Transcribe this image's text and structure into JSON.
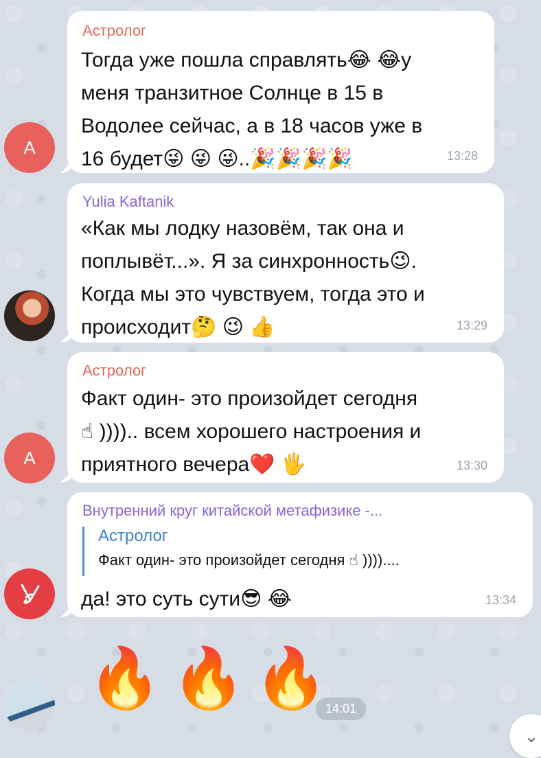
{
  "messages": [
    {
      "sender": "Астролог",
      "avatar_letter": "А",
      "lines": [
        "Тогда уже пошла справлять😂 😂у",
        "меня транзитное Солнце в 15 в",
        "Водолее сейчас, а в 18 часов уже в",
        "16 будет😜 😜 😜..🎉🎉🎉🎉"
      ],
      "time": "13:28"
    },
    {
      "sender": "Yulia Kaftanik",
      "lines": [
        "«Как мы лодку назовём, так она и",
        "поплывёт...». Я за синхронность😉.",
        "Когда мы это чувствуем, тогда это и",
        "происходит🤔 😉 👍"
      ],
      "time": "13:29"
    },
    {
      "sender": "Астролог",
      "avatar_letter": "А",
      "lines": [
        "Факт один- это произойдет сегодня",
        "☝ )))).. всем хорошего настроения и",
        "приятного вечера❤️ 🖐"
      ],
      "time": "13:30"
    },
    {
      "sender": "Внутренний круг китайской метафизике -...",
      "reply_name": "Астролог",
      "reply_text": "Факт один- это произойдет сегодня ☝ ))))....",
      "lines": [
        "да! это суть сути😎 😂"
      ],
      "time": "13:34"
    },
    {
      "emojis": [
        "🔥",
        "🔥",
        "🔥"
      ],
      "time": "14:01"
    }
  ],
  "scroll_button_icon": "⌄"
}
